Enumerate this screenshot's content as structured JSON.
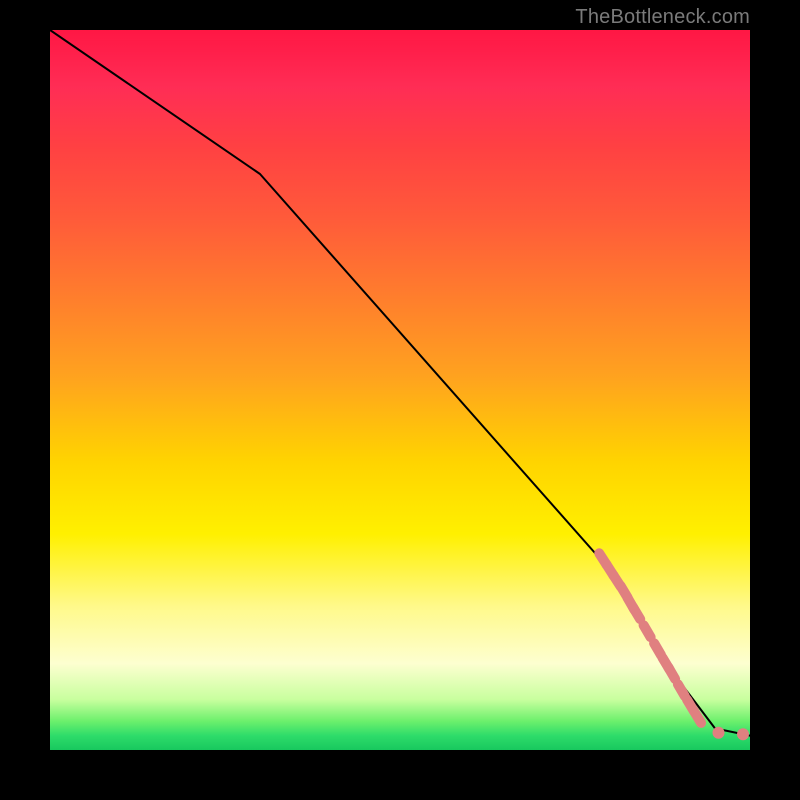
{
  "attribution": "TheBottleneck.com",
  "chart_data": {
    "type": "line",
    "xlim": [
      0,
      100
    ],
    "ylim": [
      0,
      100
    ],
    "xlabel": "",
    "ylabel": "",
    "title": "",
    "background": "rainbow-vertical",
    "series": [
      {
        "name": "curve",
        "x": [
          0,
          30,
          80,
          88,
          95,
          100
        ],
        "y": [
          100,
          80,
          25,
          12,
          3,
          2
        ],
        "stroke": "#000000",
        "width": 2
      }
    ],
    "markers": [
      {
        "name": "dash-segments",
        "style": "thick-dash",
        "color": "#e08080",
        "points": [
          {
            "x": 79,
            "y": 26.5
          },
          {
            "x": 80,
            "y": 25
          },
          {
            "x": 81,
            "y": 23.5
          },
          {
            "x": 82,
            "y": 22
          },
          {
            "x": 83,
            "y": 20.3
          },
          {
            "x": 83.8,
            "y": 19
          },
          {
            "x": 85.3,
            "y": 16.5
          },
          {
            "x": 86.8,
            "y": 14
          },
          {
            "x": 88,
            "y": 12
          },
          {
            "x": 88.8,
            "y": 10.7
          },
          {
            "x": 90.2,
            "y": 8.3
          },
          {
            "x": 91.5,
            "y": 6.2
          },
          {
            "x": 92.5,
            "y": 4.6
          }
        ]
      },
      {
        "name": "end-dots",
        "style": "dot",
        "color": "#e08080",
        "points": [
          {
            "x": 95.5,
            "y": 2.4
          },
          {
            "x": 99.0,
            "y": 2.2
          }
        ]
      }
    ]
  }
}
